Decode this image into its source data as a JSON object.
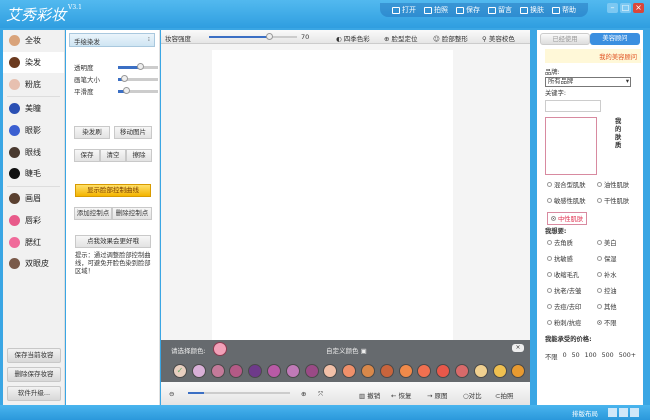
{
  "app": {
    "title": "艾秀彩妆",
    "version": "V3.1"
  },
  "toolbar": [
    {
      "label": "打开",
      "icon": "folder-icon"
    },
    {
      "label": "拍照",
      "icon": "camera-icon"
    },
    {
      "label": "保存",
      "icon": "save-icon"
    },
    {
      "label": "留言",
      "icon": "message-icon"
    },
    {
      "label": "换肤",
      "icon": "skin-icon"
    },
    {
      "label": "帮助",
      "icon": "help-icon"
    }
  ],
  "nav": [
    "全妆",
    "染发",
    "粉底",
    "美瞳",
    "眼影",
    "眼线",
    "睫毛",
    "画眉",
    "唇彩",
    "腮红",
    "双眼皮"
  ],
  "nav_colors": [
    "#d9a37a",
    "#6b3a1f",
    "#e7c0b0",
    "#2a4fb3",
    "#3b5fd1",
    "#4a3a30",
    "#111111",
    "#5a4030",
    "#e85a8a",
    "#f06a9a",
    "#7a5a4a"
  ],
  "nav_buttons": [
    "保存当前妆容",
    "删除保存妆容",
    "软件升级..."
  ],
  "panel": {
    "mode": "手绘染发",
    "sliders": [
      {
        "label": "透明度",
        "value": 0.55
      },
      {
        "label": "画笔大小",
        "value": 0.15
      },
      {
        "label": "平滑度",
        "value": 0.2
      }
    ],
    "brush": "染发刷",
    "move": "移动图片",
    "save": "保存",
    "clear": "清空",
    "erase": "擦除",
    "show_curve": "显示脸部控制曲线",
    "add_point": "添加控制点",
    "del_point": "删除控制点",
    "click_effect": "点我效果会更好哦",
    "tip": "提示：通过调整脸部控制曲线，可避免开脸色染到脸部区域！"
  },
  "canvas_toolbar": {
    "strength_label": "妆容强度",
    "strength": 70,
    "items": [
      "四季色彩",
      "脸型定位",
      "脸部整形",
      "美容校色"
    ]
  },
  "palette": {
    "choose_label": "请选择颜色:",
    "selected": "#f2a0b8",
    "custom_label": "自定义颜色",
    "colors": [
      "#e8cfc0",
      "#d9b0d8",
      "#c47a9a",
      "#b45a86",
      "#6e3a8a",
      "#b85aa6",
      "#c07ab8",
      "#9a4a86",
      "#f2c0a8",
      "#f0906a",
      "#d9884a",
      "#c8643c",
      "#f08a4a",
      "#f07050",
      "#e8584a",
      "#d86a6a",
      "#f0d090",
      "#f0c050",
      "#e89a30"
    ]
  },
  "bottom_toolbar": {
    "items": [
      "撤销",
      "恢复",
      "原图",
      "对比",
      "拍照"
    ]
  },
  "right": {
    "tabs": [
      "已经使用",
      "美容顾问"
    ],
    "advisor": "我的美容顾问",
    "brand_label": "品牌:",
    "brand": "所有品牌",
    "keyword_label": "关键字:",
    "skin_label": "我的肤质",
    "skin_types": [
      "混合型肌肤",
      "油性肌肤",
      "敏感性肌肤",
      "干性肌肤",
      "中性肌肤"
    ],
    "skin_selected": 4,
    "need_label": "我想要:",
    "needs": [
      "去角质",
      "美白",
      "抗敏感",
      "保湿",
      "收缩毛孔",
      "补水",
      "抗老/去皱",
      "控油",
      "去痘/去印",
      "其他",
      "粉刺/抗痘",
      "不限"
    ],
    "need_selected": 11,
    "price_label": "我能承受的价格:",
    "prices": [
      "不限",
      "0",
      "50",
      "100",
      "500",
      "500+"
    ]
  },
  "status": {
    "layout": "排版布局"
  }
}
